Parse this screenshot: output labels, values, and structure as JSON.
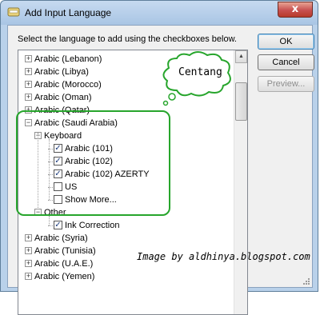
{
  "window": {
    "title": "Add Input Language",
    "close_label": "x",
    "instruction": "Select the language to add using the checkboxes below."
  },
  "buttons": {
    "ok": "OK",
    "cancel": "Cancel",
    "preview": "Preview..."
  },
  "tree": {
    "top_items": [
      "Arabic (Lebanon)",
      "Arabic (Libya)",
      "Arabic (Morocco)",
      "Arabic (Oman)",
      "Arabic (Qatar)"
    ],
    "expanded": {
      "label": "Arabic (Saudi Arabia)",
      "keyboard": {
        "label": "Keyboard",
        "items": [
          {
            "label": "Arabic (101)",
            "checked": true
          },
          {
            "label": "Arabic (102)",
            "checked": true
          },
          {
            "label": "Arabic (102) AZERTY",
            "checked": true
          },
          {
            "label": "US",
            "checked": false
          },
          {
            "label": "Show More...",
            "checked": false
          }
        ]
      },
      "other": {
        "label": "Other",
        "items": [
          {
            "label": "Ink Correction",
            "checked": true
          }
        ]
      }
    },
    "bottom_items": [
      "Arabic (Syria)",
      "Arabic (Tunisia)",
      "Arabic (U.A.E.)",
      "Arabic (Yemen)"
    ]
  },
  "annotations": {
    "callout": "Centang",
    "watermark": "Image by aldhinya.blogspot.com",
    "highlight_color": "#27a52c"
  }
}
